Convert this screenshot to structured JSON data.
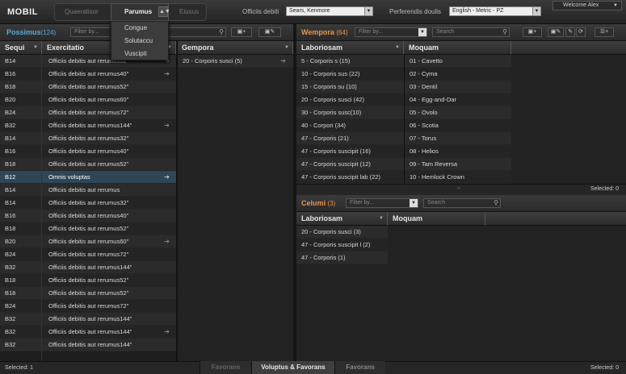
{
  "app": {
    "logo": "MOBIL"
  },
  "modes": {
    "items": [
      "Quaeratisor",
      "Parumus",
      "Eiusus"
    ],
    "active": "Parumus"
  },
  "mode_menu": [
    "Congue",
    "Solutaccu",
    "Vuscipit"
  ],
  "header": {
    "officiis_label": "Officiis debiti",
    "officiis_value": "Sears, Kenmore",
    "perferendis_label": "Perferendis doulis",
    "perferendis_value": "English - Metric - PZ",
    "welcome": "Welcome Alex"
  },
  "left_panel": {
    "title": "Possimus",
    "count": "(124)",
    "filter_placeholder": "Filter by...",
    "columns": [
      "Sequi",
      "Exercitatio"
    ],
    "rows": [
      {
        "code": "B14",
        "text": "Officiis debitis aut rerumus32\""
      },
      {
        "code": "B16",
        "text": "Officiis debitis aut rerumus40\""
      },
      {
        "code": "B18",
        "text": "Officiis debitis aut rerumus52\""
      },
      {
        "code": "B20",
        "text": "Officiis debitis aut rerumus60\""
      },
      {
        "code": "B24",
        "text": "Officiis debitis aut rerumus72\""
      },
      {
        "code": "B32",
        "text": "Officiis debitis aut rerumus144\""
      },
      {
        "code": "B14",
        "text": "Officiis debitis aut rerumus32\""
      },
      {
        "code": "B16",
        "text": "Officiis debitis aut rerumus40\""
      },
      {
        "code": "B18",
        "text": "Officiis debitis aut rerumus52\""
      },
      {
        "code": "B12",
        "text": "Omnis voluptas"
      },
      {
        "code": "B14",
        "text": "Officiis debitis aut rerumus"
      },
      {
        "code": "B14",
        "text": "Officiis debitis aut rerumus32\""
      },
      {
        "code": "B16",
        "text": "Officiis debitis aut rerumus40\""
      },
      {
        "code": "B18",
        "text": "Officiis debitis aut rerumus52\""
      },
      {
        "code": "B20",
        "text": "Officiis debitis aut rerumus60\""
      },
      {
        "code": "B24",
        "text": "Officiis debitis aut rerumus72\""
      },
      {
        "code": "B32",
        "text": "Officiis debitis aut rerumus144\""
      },
      {
        "code": "B18",
        "text": "Officiis debitis aut rerumus52\""
      },
      {
        "code": "B18",
        "text": "Officiis debitis aut rerumus52\""
      },
      {
        "code": "B24",
        "text": "Officiis debitis aut rerumus72\""
      },
      {
        "code": "B32",
        "text": "Officiis debitis aut rerumus144\""
      },
      {
        "code": "B32",
        "text": "Officiis debitis aut rerumus144\""
      },
      {
        "code": "B32",
        "text": "Officiis debitis aut rerumus144\""
      }
    ],
    "arrow_rows": [
      0,
      1,
      5,
      9,
      14,
      21
    ],
    "selected_row": 9,
    "gempora_header": "Gempora",
    "gempora_rows": [
      "20 - Corporis susci  (5)"
    ],
    "status": "Selected: 1"
  },
  "right_top": {
    "title": "Wempora",
    "count": "(64)",
    "filter_placeholder": "Filter by...",
    "search_placeholder": "Search",
    "columns": [
      "Laboriosam",
      "Moquam"
    ],
    "col1": [
      "5 - Corporis s  (15)",
      "10 - Corporis sus  (22)",
      "15 - Corporis su  (10)",
      "20 - Corporis susci   (42)",
      "30 - Corporis susc(10)",
      "40 - Corpori  (34)",
      "47 - Corporis    (21)",
      "47 - Corporis suscipit   (16)",
      "47 - Corporis suscipit (12)",
      "47 - Corporis suscipit lab   (22)"
    ],
    "col2": [
      "01 - Cavetto",
      "02 - Cyma",
      "03 - Dentil",
      "04 - Egg-and-Dar",
      "05 - Ovolo",
      "06 - Scotia",
      "07 - Torus",
      "08 - Helios",
      "09 - Tam Reversa",
      "10 - Hemlock Crown"
    ],
    "status": "Selected: 0"
  },
  "right_bottom": {
    "title": "Celumi",
    "count": "(3)",
    "filter_placeholder": "Filter by...",
    "search_placeholder": "Search",
    "columns": [
      "Laboriosam",
      "Moquam"
    ],
    "col1": [
      "20 - Corporis susci  (3)",
      "47 - Corporis suscipit l (2)",
      "47 - Corporis    (1)"
    ],
    "status": "Selected: 0"
  },
  "bottom_tabs": [
    "Favorans",
    "Voluptus & Favorans",
    "Favorans"
  ],
  "colors": {
    "accent": "#e8944a",
    "blue": "#5aa8d8",
    "selected_row": "#2e4656"
  }
}
